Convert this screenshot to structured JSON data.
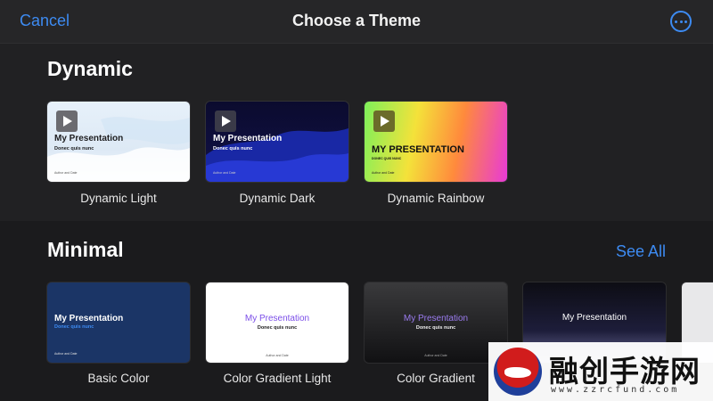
{
  "header": {
    "cancel_label": "Cancel",
    "title": "Choose a Theme",
    "more_icon": "ellipsis-circle-icon"
  },
  "sections": {
    "dynamic": {
      "title": "Dynamic",
      "themes": [
        {
          "name": "Dynamic Light",
          "preview_title": "My Presentation",
          "preview_subtitle": "Donec quis nunc",
          "preview_author": "Author and Date",
          "has_play_icon": true
        },
        {
          "name": "Dynamic Dark",
          "preview_title": "My Presentation",
          "preview_subtitle": "Donec quis nunc",
          "preview_author": "Author and Date",
          "has_play_icon": true
        },
        {
          "name": "Dynamic Rainbow",
          "preview_title": "MY PRESENTATION",
          "preview_subtitle": "DONEC QUIS NUNC",
          "preview_author": "Author and Date",
          "has_play_icon": true
        }
      ]
    },
    "minimal": {
      "title": "Minimal",
      "see_all_label": "See All",
      "themes": [
        {
          "name": "Basic Color",
          "preview_title": "My Presentation",
          "preview_subtitle": "Donec quis nunc",
          "preview_author": "Author and Date"
        },
        {
          "name": "Color Gradient Light",
          "preview_title": "My Presentation",
          "preview_subtitle": "Donec quis nunc",
          "preview_author": "Author and Date"
        },
        {
          "name": "Color Gradient",
          "preview_title": "My Presentation",
          "preview_subtitle": "Donec quis nunc",
          "preview_author": "Author and Date"
        },
        {
          "name": "",
          "preview_title": "My Presentation",
          "preview_subtitle": "",
          "preview_author": ""
        }
      ]
    }
  },
  "watermark": {
    "text": "融创手游网",
    "url": "www.zzrcfund.com"
  },
  "colors": {
    "accent": "#3d8bf2",
    "background": "#1c1c1e",
    "header": "#262628"
  }
}
